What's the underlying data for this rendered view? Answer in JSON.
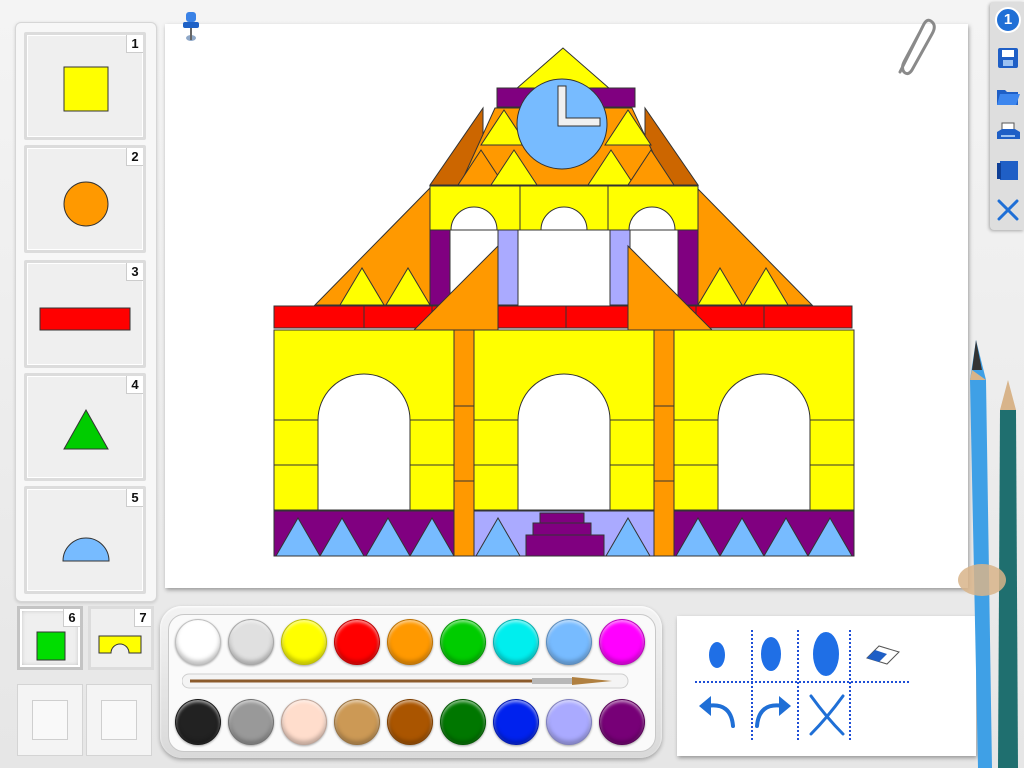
{
  "window": {
    "badge_count": "1"
  },
  "shapes": [
    {
      "number": "1",
      "name": "square",
      "color": "#ffff00"
    },
    {
      "number": "2",
      "name": "circle",
      "color": "#ff9900"
    },
    {
      "number": "3",
      "name": "rectangle",
      "color": "#ff0000"
    },
    {
      "number": "4",
      "name": "triangle",
      "color": "#00cc00"
    },
    {
      "number": "5",
      "name": "half-circle",
      "color": "#77bbff"
    },
    {
      "number": "6",
      "name": "small-square",
      "color": "#00dd00"
    },
    {
      "number": "7",
      "name": "arch",
      "color": "#ffff00"
    }
  ],
  "toolbar": {
    "buttons": [
      "save-icon",
      "open-folder-icon",
      "print-icon",
      "new-page-icon",
      "close-icon"
    ]
  },
  "palette": {
    "colors_top": [
      "#ffffff",
      "#e0e0e0",
      "#ffff00",
      "#ff0000",
      "#ff9900",
      "#00cc00",
      "#00eeee",
      "#77bbff",
      "#ff00ff"
    ],
    "colors_bottom": [
      "#222222",
      "#999999",
      "#ffddcc",
      "#cc9955",
      "#aa5500",
      "#007700",
      "#0022ee",
      "#aaaaff",
      "#770077"
    ]
  },
  "tools": [
    "brush-small-icon",
    "brush-medium-icon",
    "brush-large-icon",
    "eraser-icon",
    "undo-icon",
    "redo-icon",
    "clear-icon"
  ],
  "colors": {
    "accent": "#1f6fd6",
    "purple": "#800080",
    "orange": "#ff9900",
    "yellow": "#ffff00",
    "red": "#ff0000",
    "lightblue": "#77bbff",
    "lavender": "#aaaaff"
  }
}
